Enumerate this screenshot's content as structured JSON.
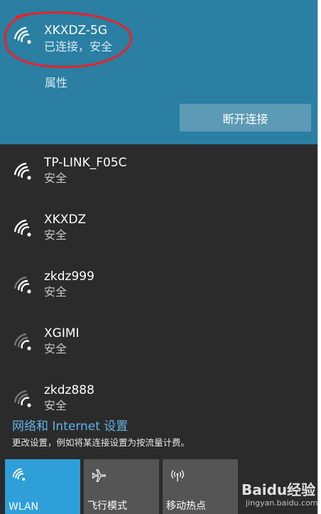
{
  "connected_network": {
    "name": "XKXDZ-5G",
    "status": "已连接，安全",
    "properties_label": "属性",
    "disconnect_label": "断开连接"
  },
  "networks": [
    {
      "name": "TP-LINK_F05C",
      "status": "安全",
      "signal": "full"
    },
    {
      "name": "XKXDZ",
      "status": "安全",
      "signal": "full"
    },
    {
      "name": "zkdz999",
      "status": "安全",
      "signal": "medium"
    },
    {
      "name": "XGIMI",
      "status": "安全",
      "signal": "low"
    },
    {
      "name": "zkdz888",
      "status": "安全",
      "signal": "low"
    }
  ],
  "footer": {
    "settings_link": "网络和 Internet 设置",
    "description": "更改设置，例如将某连接设置为按流量计费。"
  },
  "quick_actions": [
    {
      "label": "WLAN",
      "icon": "wifi-icon",
      "active": true
    },
    {
      "label": "飞行模式",
      "icon": "airplane-icon",
      "active": false
    },
    {
      "label": "移动热点",
      "icon": "hotspot-icon",
      "active": false
    }
  ],
  "watermark": {
    "brand": "Baidu经验",
    "url": "jingyan.baidu.com"
  },
  "colors": {
    "panel_bg": "#2b2b2b",
    "connected_bg": "#2a7fa3",
    "accent_tile": "#2e9fd9",
    "link_blue": "#5fb3e8",
    "annotation_red": "#e8232a"
  }
}
